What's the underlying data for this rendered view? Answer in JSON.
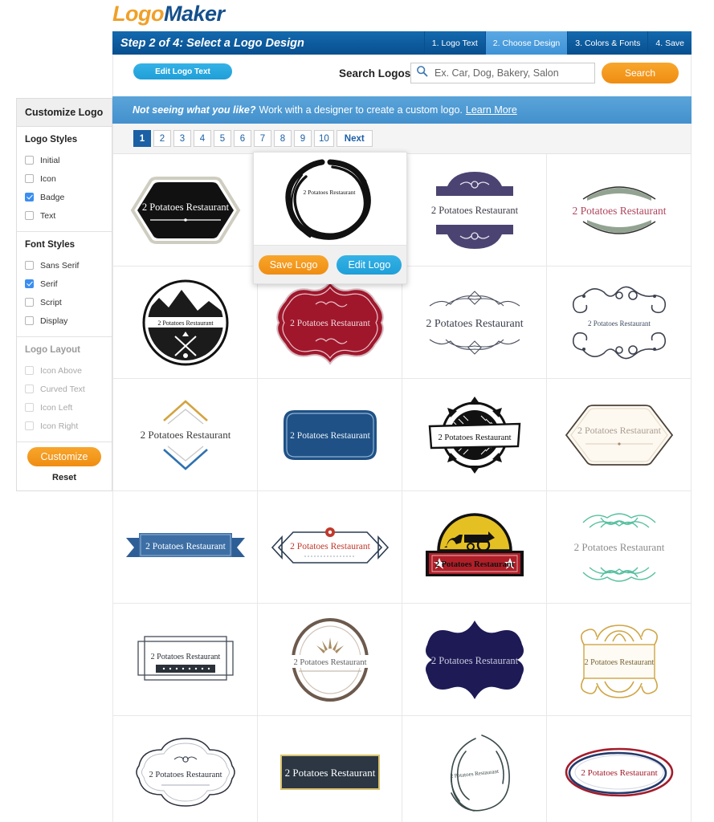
{
  "brand": {
    "part1": "Logo",
    "part2": "Maker"
  },
  "header": {
    "step_title": "Step 2 of 4: Select a Logo Design",
    "tabs": [
      {
        "label": "1. Logo Text",
        "active": false
      },
      {
        "label": "2. Choose Design",
        "active": true
      },
      {
        "label": "3. Colors & Fonts",
        "active": false
      },
      {
        "label": "4. Save",
        "active": false
      }
    ]
  },
  "toolbar": {
    "edit_logo_text_label": "Edit Logo Text",
    "search_label": "Search Logos",
    "search_placeholder": "Ex. Car, Dog, Bakery, Salon",
    "search_value": "",
    "search_button_label": "Search",
    "search_icon": "search-icon"
  },
  "banner": {
    "bold_text": "Not seeing what you like?",
    "text": "Work with a designer to create a custom logo.",
    "link_text": "Learn More"
  },
  "pagination": {
    "pages": [
      "1",
      "2",
      "3",
      "4",
      "5",
      "6",
      "7",
      "8",
      "9",
      "10"
    ],
    "active_page": "1",
    "next_label": "Next"
  },
  "sidebar": {
    "title": "Customize Logo",
    "sections": [
      {
        "title": "Logo Styles",
        "disabled": false,
        "options": [
          {
            "label": "Initial",
            "checked": false
          },
          {
            "label": "Icon",
            "checked": false
          },
          {
            "label": "Badge",
            "checked": true
          },
          {
            "label": "Text",
            "checked": false
          }
        ]
      },
      {
        "title": "Font Styles",
        "disabled": false,
        "options": [
          {
            "label": "Sans Serif",
            "checked": false
          },
          {
            "label": "Serif",
            "checked": true
          },
          {
            "label": "Script",
            "checked": false
          },
          {
            "label": "Display",
            "checked": false
          }
        ]
      },
      {
        "title": "Logo Layout",
        "disabled": true,
        "options": [
          {
            "label": "Icon Above",
            "checked": false
          },
          {
            "label": "Curved Text",
            "checked": false
          },
          {
            "label": "Icon Left",
            "checked": false
          },
          {
            "label": "Icon Right",
            "checked": false
          }
        ]
      }
    ],
    "customize_label": "Customize",
    "reset_label": "Reset"
  },
  "hover_card": {
    "logo_text": "2 Potatoes Restaurant",
    "save_label": "Save Logo",
    "edit_label": "Edit Logo"
  },
  "grid": {
    "logo_text": "2 Potatoes Restaurant",
    "items": [
      {
        "style": "black-hexagon-badge",
        "text": "2 Potatoes Restaurant"
      },
      {
        "style": "brush-circle",
        "text": "2 Potatoes Restaurant"
      },
      {
        "style": "purple-ornament-banner",
        "text": "2 Potatoes Restaurant"
      },
      {
        "style": "sage-arc-crimson-text",
        "text": "2 Potatoes Restaurant"
      },
      {
        "style": "mountain-circle-emblem",
        "text": "2 Potatoes Restaurant"
      },
      {
        "style": "crimson-scalloped-badge",
        "text": "2 Potatoes Restaurant"
      },
      {
        "style": "flourish-divider",
        "text": "2 Potatoes Restaurant"
      },
      {
        "style": "scroll-frame",
        "text": "2 Potatoes Restaurant"
      },
      {
        "style": "gold-chevron-stack",
        "text": "2 Potatoes Restaurant"
      },
      {
        "style": "blue-plaque",
        "text": "2 Potatoes Restaurant"
      },
      {
        "style": "black-sunburst-banner",
        "text": "2 Potatoes Restaurant"
      },
      {
        "style": "cream-hexagon-outline",
        "text": "2 Potatoes Restaurant"
      },
      {
        "style": "blue-ribbon",
        "text": "2 Potatoes Restaurant"
      },
      {
        "style": "red-hex-dot",
        "text": "2 Potatoes Restaurant"
      },
      {
        "style": "red-carriage-crest",
        "text": "2 Potatoes Restaurant"
      },
      {
        "style": "teal-filigree",
        "text": "2 Potatoes Restaurant"
      },
      {
        "style": "double-rectangle-frame",
        "text": "2 Potatoes Restaurant"
      },
      {
        "style": "brown-oval-fan",
        "text": "2 Potatoes Restaurant"
      },
      {
        "style": "navy-quatrefoil",
        "text": "2 Potatoes Restaurant"
      },
      {
        "style": "gold-crown-frame",
        "text": "2 Potatoes Restaurant"
      },
      {
        "style": "cloud-outline-plaque",
        "text": "2 Potatoes Restaurant"
      },
      {
        "style": "dark-gold-rectangle",
        "text": "2 Potatoes Restaurant"
      },
      {
        "style": "sketch-oval-rings",
        "text": "2 Potatoes Restaurant"
      },
      {
        "style": "red-navy-ellipse",
        "text": "2 Potatoes Restaurant"
      }
    ]
  }
}
